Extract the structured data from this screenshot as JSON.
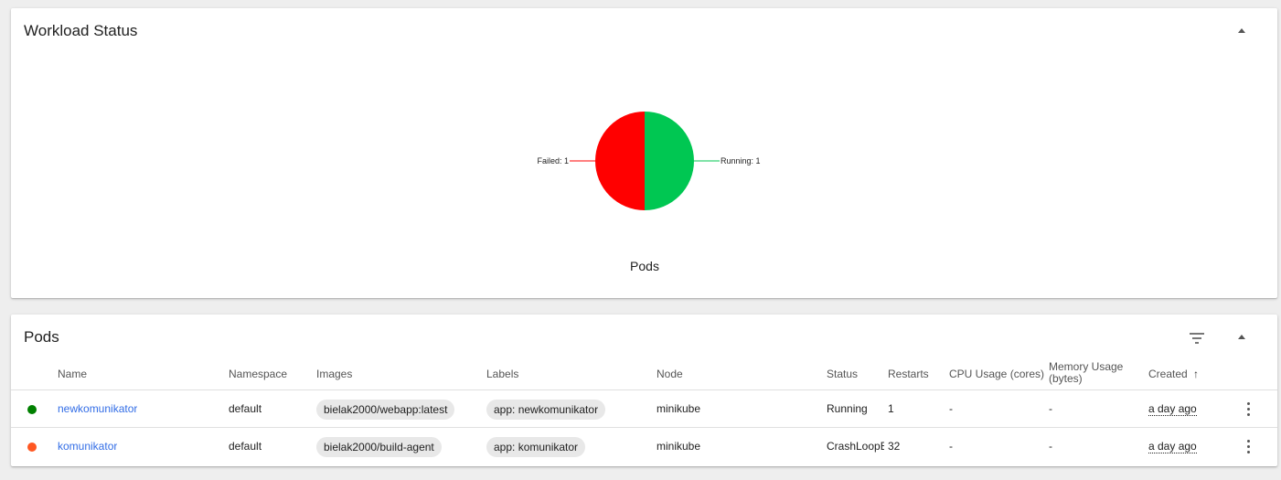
{
  "workload": {
    "title": "Workload Status",
    "chart_title": "Pods"
  },
  "chart_data": {
    "type": "pie",
    "title": "Pods",
    "slices": [
      {
        "label": "Running",
        "value": 1,
        "color": "#00c752",
        "text": "Running: 1"
      },
      {
        "label": "Failed",
        "value": 1,
        "color": "#ff0000",
        "text": "Failed: 1"
      }
    ]
  },
  "pods": {
    "title": "Pods",
    "columns": {
      "name": "Name",
      "namespace": "Namespace",
      "images": "Images",
      "labels": "Labels",
      "node": "Node",
      "status": "Status",
      "restarts": "Restarts",
      "cpu": "CPU Usage (cores)",
      "memory": "Memory Usage (bytes)",
      "created": "Created",
      "created_sort": "↑"
    },
    "rows": [
      {
        "status_color": "#008000",
        "name": "newkomunikator",
        "namespace": "default",
        "image": "bielak2000/webapp:latest",
        "label": "app: newkomunikator",
        "node": "minikube",
        "status": "Running",
        "restarts": "1",
        "cpu": "-",
        "memory": "-",
        "created": "a day ago"
      },
      {
        "status_color": "#ff5722",
        "name": "komunikator",
        "namespace": "default",
        "image": "bielak2000/build-agent",
        "label": "app: komunikator",
        "node": "minikube",
        "status": "CrashLoopE",
        "restarts": "32",
        "cpu": "-",
        "memory": "-",
        "created": "a day ago"
      }
    ]
  }
}
